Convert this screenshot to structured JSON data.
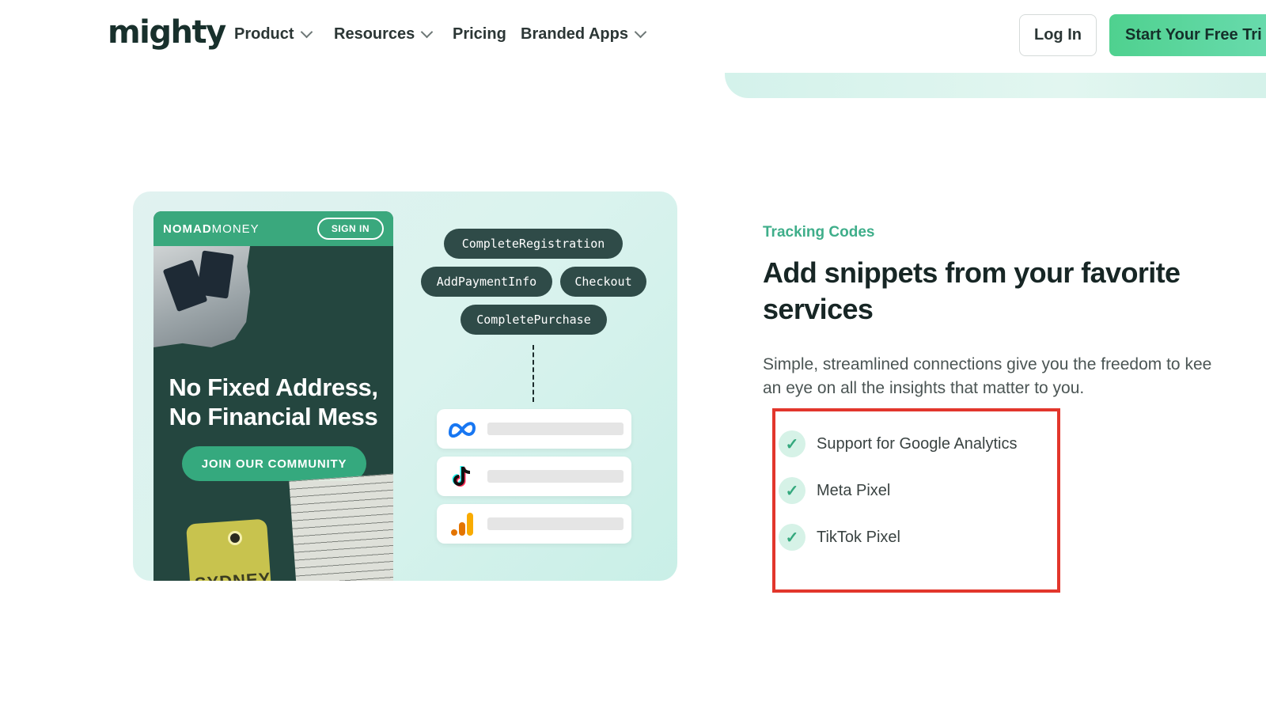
{
  "nav": {
    "logo": "mighty",
    "items": [
      {
        "label": "Product",
        "has_dropdown": true
      },
      {
        "label": "Resources",
        "has_dropdown": true
      },
      {
        "label": "Pricing",
        "has_dropdown": false
      },
      {
        "label": "Branded Apps",
        "has_dropdown": true
      }
    ],
    "login": "Log In",
    "cta": "Start Your Free Tri"
  },
  "illustration": {
    "phone": {
      "brand_bold": "NOMAD",
      "brand_light": "MONEY",
      "sign_in": "SIGN IN",
      "headline_1": "No Fixed Address,",
      "headline_2": "No Financial Mess",
      "join": "JOIN OUR COMMUNITY",
      "tag": "SYDNEY"
    },
    "events": [
      "CompleteRegistration",
      "AddPaymentInfo",
      "Checkout",
      "CompletePurchase"
    ],
    "services": [
      "meta-logo",
      "tiktok-logo",
      "google-analytics-logo"
    ]
  },
  "section": {
    "eyebrow": "Tracking Codes",
    "title": "Add snippets from your favorite services",
    "desc_1": "Simple, streamlined connections give you the freedom to kee",
    "desc_2": "an eye on all the insights that matter to you.",
    "features": [
      "Support for Google Analytics",
      "Meta Pixel",
      "TikTok Pixel"
    ]
  },
  "colors": {
    "accent": "#3fae8a",
    "cta": "#4fd18f",
    "highlight_border": "#e2362c",
    "dark_pill": "#2f4b48"
  }
}
